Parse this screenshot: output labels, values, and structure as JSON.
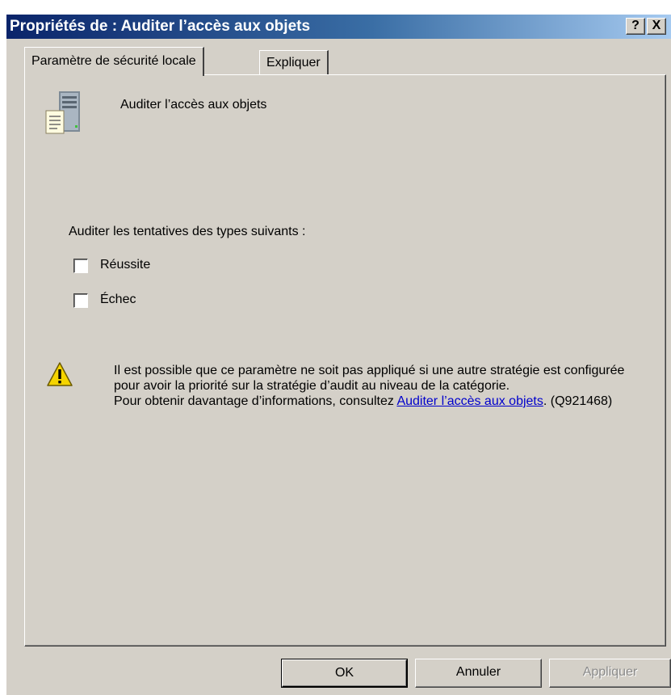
{
  "window": {
    "title": "Propriétés de : Auditer l’accès aux objets",
    "help_btn": "?",
    "close_btn": "X"
  },
  "tabs": [
    {
      "label": "Paramètre de sécurité locale",
      "active": true
    },
    {
      "label": "Expliquer",
      "active": false
    }
  ],
  "setting": {
    "title": "Auditer l’accès aux objets",
    "icon": "server-document-icon"
  },
  "audit": {
    "label": "Auditer les tentatives des types suivants :",
    "options": [
      {
        "label": "Réussite",
        "checked": false
      },
      {
        "label": "Échec",
        "checked": false
      }
    ]
  },
  "warning": {
    "icon": "warning-icon",
    "text1": "Il est possible que ce paramètre ne soit pas appliqué si une autre stratégie est configurée pour avoir la priorité sur la stratégie d’audit au niveau de la catégorie.",
    "text2": "Pour obtenir davantage d’informations, consultez ",
    "link": "Auditer l’accès aux objets",
    "suffix": ". (Q921468)"
  },
  "buttons": {
    "ok": "OK",
    "cancel": "Annuler",
    "apply": "Appliquer"
  },
  "colors": {
    "titlebar_start": "#0a246a",
    "titlebar_end": "#a6caf0",
    "dialog_bg": "#d4d0c8",
    "link": "#0000cc"
  }
}
